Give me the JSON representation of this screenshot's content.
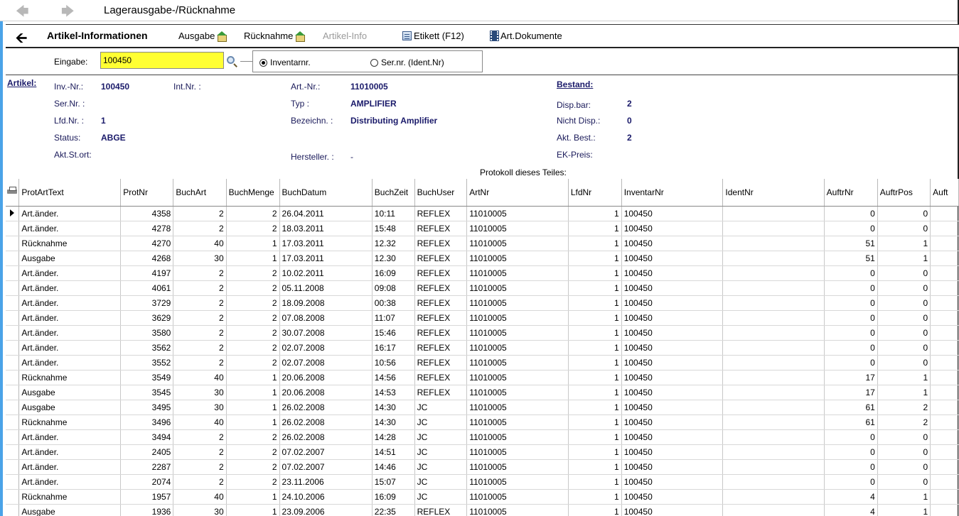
{
  "window": {
    "title": "Lagerausgabe-/Rücknahme"
  },
  "toolbar": {
    "title": "Artikel-Informationen",
    "ausgabe": "Ausgabe",
    "ruecknahme": "Rücknahme",
    "artikel_info": "Artikel-Info",
    "etikett": "Etikett (F12)",
    "dokumente": "Art.Dokumente"
  },
  "eingabe": {
    "label": "Eingabe:",
    "value": "100450",
    "radio_inventar": "Inventarnr.",
    "radio_sernr": "Ser.nr. (Ident.Nr)",
    "selected": "inventar"
  },
  "artikel": {
    "section": "Artikel:",
    "inv_nr_label": "Inv.-Nr.:",
    "inv_nr": "100450",
    "int_nr_label": "Int.Nr. :",
    "ser_nr_label": "Ser.Nr. :",
    "lfd_nr_label": "Lfd.Nr. :",
    "lfd_nr": "1",
    "status_label": "Status:",
    "status": "ABGE",
    "akt_stort_label": "Akt.St.ort:",
    "art_nr_label": "Art.-Nr.:",
    "art_nr": "11010005",
    "typ_label": "Typ :",
    "typ": "AMPLIFIER",
    "bezeichn_label": "Bezeichn. :",
    "bezeichn": "Distributing Amplifier",
    "hersteller_label": "Hersteller. :",
    "hersteller": "-"
  },
  "bestand": {
    "section": "Bestand:",
    "disp_label": "Disp.bar:",
    "disp": "2",
    "nicht_disp_label": "Nicht Disp.:",
    "nicht_disp": "0",
    "akt_best_label": "Akt. Best.:",
    "akt_best": "2",
    "ek_preis_label": "EK-Preis:"
  },
  "protokoll_title": "Protokoll dieses Teiles:",
  "table": {
    "columns": [
      "ProtArtText",
      "ProtNr",
      "BuchArt",
      "BuchMenge",
      "BuchDatum",
      "BuchZeit",
      "BuchUser",
      "ArtNr",
      "LfdNr",
      "InventarNr",
      "IdentNr",
      "AuftrNr",
      "AuftrPos",
      "Auft"
    ],
    "rows": [
      [
        "Art.änder.",
        "4358",
        "2",
        "2",
        "26.04.2011",
        "10:11",
        "REFLEX",
        "11010005",
        "1",
        "100450",
        "",
        "0",
        "0"
      ],
      [
        "Art.änder.",
        "4278",
        "2",
        "2",
        "18.03.2011",
        "15:48",
        "REFLEX",
        "11010005",
        "1",
        "100450",
        "",
        "0",
        "0"
      ],
      [
        "Rücknahme",
        "4270",
        "40",
        "1",
        "17.03.2011",
        "12.32",
        "REFLEX",
        "11010005",
        "1",
        "100450",
        "",
        "51",
        "1"
      ],
      [
        "Ausgabe",
        "4268",
        "30",
        "1",
        "17.03.2011",
        "12.30",
        "REFLEX",
        "11010005",
        "1",
        "100450",
        "",
        "51",
        "1"
      ],
      [
        "Art.änder.",
        "4197",
        "2",
        "2",
        "10.02.2011",
        "16:09",
        "REFLEX",
        "11010005",
        "1",
        "100450",
        "",
        "0",
        "0"
      ],
      [
        "Art.änder.",
        "4061",
        "2",
        "2",
        "05.11.2008",
        "09:08",
        "REFLEX",
        "11010005",
        "1",
        "100450",
        "",
        "0",
        "0"
      ],
      [
        "Art.änder.",
        "3729",
        "2",
        "2",
        "18.09.2008",
        "00:38",
        "REFLEX",
        "11010005",
        "1",
        "100450",
        "",
        "0",
        "0"
      ],
      [
        "Art.änder.",
        "3629",
        "2",
        "2",
        "07.08.2008",
        "11:07",
        "REFLEX",
        "11010005",
        "1",
        "100450",
        "",
        "0",
        "0"
      ],
      [
        "Art.änder.",
        "3580",
        "2",
        "2",
        "30.07.2008",
        "15:46",
        "REFLEX",
        "11010005",
        "1",
        "100450",
        "",
        "0",
        "0"
      ],
      [
        "Art.änder.",
        "3562",
        "2",
        "2",
        "02.07.2008",
        "16:17",
        "REFLEX",
        "11010005",
        "1",
        "100450",
        "",
        "0",
        "0"
      ],
      [
        "Art.änder.",
        "3552",
        "2",
        "2",
        "02.07.2008",
        "10:56",
        "REFLEX",
        "11010005",
        "1",
        "100450",
        "",
        "0",
        "0"
      ],
      [
        "Rücknahme",
        "3549",
        "40",
        "1",
        "20.06.2008",
        "14:56",
        "REFLEX",
        "11010005",
        "1",
        "100450",
        "",
        "17",
        "1"
      ],
      [
        "Ausgabe",
        "3545",
        "30",
        "1",
        "20.06.2008",
        "14:53",
        "REFLEX",
        "11010005",
        "1",
        "100450",
        "",
        "17",
        "1"
      ],
      [
        "Ausgabe",
        "3495",
        "30",
        "1",
        "26.02.2008",
        "14:30",
        "JC",
        "11010005",
        "1",
        "100450",
        "",
        "61",
        "2"
      ],
      [
        "Rücknahme",
        "3496",
        "40",
        "1",
        "26.02.2008",
        "14:30",
        "JC",
        "11010005",
        "1",
        "100450",
        "",
        "61",
        "2"
      ],
      [
        "Art.änder.",
        "3494",
        "2",
        "2",
        "26.02.2008",
        "14:28",
        "JC",
        "11010005",
        "1",
        "100450",
        "",
        "0",
        "0"
      ],
      [
        "Art.änder.",
        "2405",
        "2",
        "2",
        "07.02.2007",
        "14:51",
        "JC",
        "11010005",
        "1",
        "100450",
        "",
        "0",
        "0"
      ],
      [
        "Art.änder.",
        "2287",
        "2",
        "2",
        "07.02.2007",
        "14:46",
        "JC",
        "11010005",
        "1",
        "100450",
        "",
        "0",
        "0"
      ],
      [
        "Art.änder.",
        "2074",
        "2",
        "2",
        "23.11.2006",
        "15:07",
        "JC",
        "11010005",
        "1",
        "100450",
        "",
        "0",
        "0"
      ],
      [
        "Rücknahme",
        "1957",
        "40",
        "1",
        "24.10.2006",
        "16:09",
        "JC",
        "11010005",
        "1",
        "100450",
        "",
        "4",
        "1"
      ],
      [
        "Ausgabe",
        "1936",
        "30",
        "1",
        "23.09.2006",
        "22:35",
        "REFLEX",
        "11010005",
        "1",
        "100450",
        "",
        "4",
        "1"
      ]
    ]
  }
}
